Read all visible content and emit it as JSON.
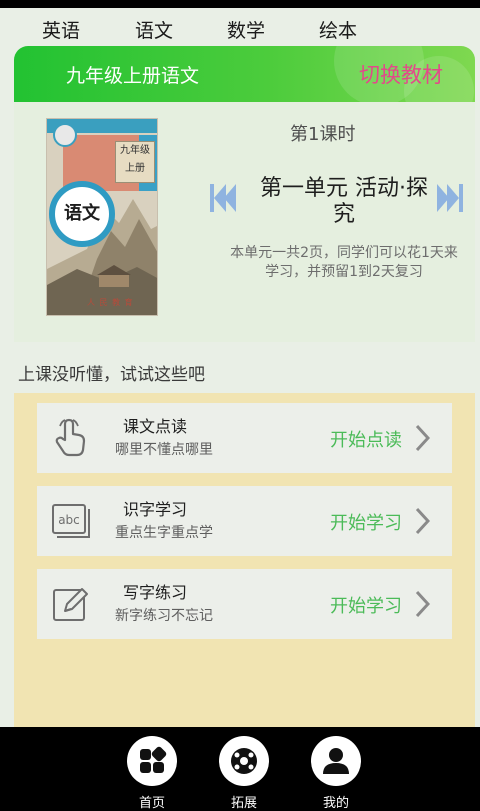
{
  "subject_tabs": [
    {
      "label": "英语"
    },
    {
      "label": "语文"
    },
    {
      "label": "数学"
    },
    {
      "label": "绘本"
    }
  ],
  "header": {
    "grade_title": "九年级上册语文",
    "switch_label": "切换教材"
  },
  "book": {
    "grade": "九年级",
    "volume": "上册",
    "subject": "语文"
  },
  "lesson": {
    "period": "第1课时",
    "unit_title": "第一单元 活动·探究",
    "description": "本单元一共2页，同学们可以花1天来学习，并预留1到2天复习"
  },
  "tip": "上课没听懂，试试这些吧",
  "cards": [
    {
      "title": "课文点读",
      "subtitle": "哪里不懂点哪里",
      "action": "开始点读",
      "icon": "hand-tap-icon"
    },
    {
      "title": "识字学习",
      "subtitle": "重点生字重点学",
      "action": "开始学习",
      "icon": "abc-icon"
    },
    {
      "title": "写字练习",
      "subtitle": "新字练习不忘记",
      "action": "开始学习",
      "icon": "pencil-edit-icon"
    }
  ],
  "bottom_nav": [
    {
      "label": "首页",
      "icon": "home-grid-icon"
    },
    {
      "label": "拓展",
      "icon": "explore-icon"
    },
    {
      "label": "我的",
      "icon": "profile-icon"
    }
  ],
  "colors": {
    "header_green": "#22c232",
    "switch_pink": "#e24a8a",
    "action_green": "#4bbb58",
    "activity_bg": "#f1e4b2",
    "arrow_blue": "#8fb3e0"
  }
}
